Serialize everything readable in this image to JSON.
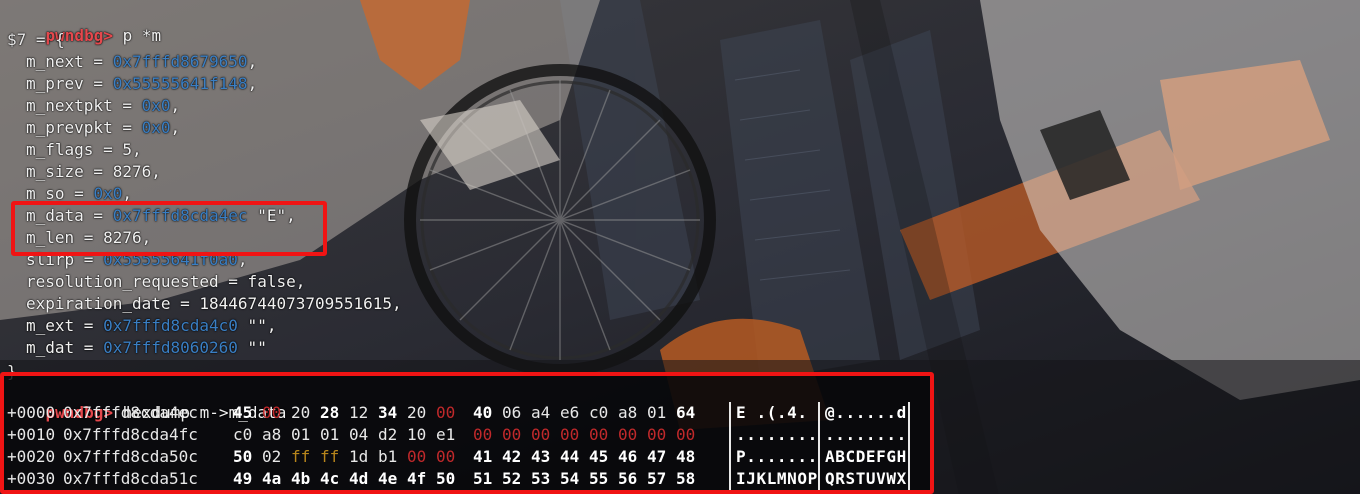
{
  "colors": {
    "prompt": "#e5484d",
    "address": "#3a7fc4",
    "highlight_border": "#f01414",
    "zero_byte": "#c0292b",
    "ff_byte": "#b8861b"
  },
  "print_cmd": {
    "prompt": "pwndbg>",
    "command": " p *m",
    "result_open": "$7 = {",
    "result_close": "}"
  },
  "fields": [
    {
      "name": "m_next = ",
      "addr": "0x7fffd8679650",
      "rest": ","
    },
    {
      "name": "m_prev = ",
      "addr": "0x55555641f148",
      "rest": ","
    },
    {
      "name": "m_nextpkt = ",
      "addr": "0x0",
      "rest": ","
    },
    {
      "name": "m_prevpkt = ",
      "addr": "0x0",
      "rest": ","
    },
    {
      "name": "m_flags = 5,",
      "addr": "",
      "rest": ""
    },
    {
      "name": "m_size = 8276,",
      "addr": "",
      "rest": ""
    },
    {
      "name": "m_so = ",
      "addr": "0x0",
      "rest": ","
    },
    {
      "name": "m_data = ",
      "addr": "0x7fffd8cda4ec",
      "rest": " \"E\","
    },
    {
      "name": "m_len = 8276,",
      "addr": "",
      "rest": ""
    },
    {
      "name": "slirp = ",
      "addr": "0x55555641f0a0",
      "rest": ","
    },
    {
      "name": "resolution_requested = false,",
      "addr": "",
      "rest": ""
    },
    {
      "name": "expiration_date = 18446744073709551615,",
      "addr": "",
      "rest": ""
    },
    {
      "name": "m_ext = ",
      "addr": "0x7fffd8cda4c0",
      "rest": " \"\","
    },
    {
      "name": "m_dat = ",
      "addr": "0x7fffd8060260",
      "rest": " \"\""
    }
  ],
  "hexdump_cmd": {
    "prompt": "pwndbg>",
    "command": " hexdump m->m_data"
  },
  "hexdump": [
    {
      "offset": "+0000",
      "address": "0x7fffd8cda4ec",
      "bytes": [
        {
          "v": "45",
          "s": "bold"
        },
        {
          "v": "00",
          "s": "red"
        },
        {
          "v": "20",
          "s": "norm"
        },
        {
          "v": "28",
          "s": "bold"
        },
        {
          "v": "12",
          "s": "norm"
        },
        {
          "v": "34",
          "s": "bold"
        },
        {
          "v": "20",
          "s": "norm"
        },
        {
          "v": "00",
          "s": "red"
        },
        {
          "v": "40",
          "s": "bold"
        },
        {
          "v": "06",
          "s": "norm"
        },
        {
          "v": "a4",
          "s": "norm"
        },
        {
          "v": "e6",
          "s": "norm"
        },
        {
          "v": "c0",
          "s": "norm"
        },
        {
          "v": "a8",
          "s": "norm"
        },
        {
          "v": "01",
          "s": "norm"
        },
        {
          "v": "64",
          "s": "bold"
        }
      ],
      "ascii1": "E .(.4. ",
      "ascii2": "@......d"
    },
    {
      "offset": "+0010",
      "address": "0x7fffd8cda4fc",
      "bytes": [
        {
          "v": "c0",
          "s": "norm"
        },
        {
          "v": "a8",
          "s": "norm"
        },
        {
          "v": "01",
          "s": "norm"
        },
        {
          "v": "01",
          "s": "norm"
        },
        {
          "v": "04",
          "s": "norm"
        },
        {
          "v": "d2",
          "s": "norm"
        },
        {
          "v": "10",
          "s": "norm"
        },
        {
          "v": "e1",
          "s": "norm"
        },
        {
          "v": "00",
          "s": "red"
        },
        {
          "v": "00",
          "s": "red"
        },
        {
          "v": "00",
          "s": "red"
        },
        {
          "v": "00",
          "s": "red"
        },
        {
          "v": "00",
          "s": "red"
        },
        {
          "v": "00",
          "s": "red"
        },
        {
          "v": "00",
          "s": "red"
        },
        {
          "v": "00",
          "s": "red"
        }
      ],
      "ascii1": "........",
      "ascii2": "........"
    },
    {
      "offset": "+0020",
      "address": "0x7fffd8cda50c",
      "bytes": [
        {
          "v": "50",
          "s": "bold"
        },
        {
          "v": "02",
          "s": "norm"
        },
        {
          "v": "ff",
          "s": "yel"
        },
        {
          "v": "ff",
          "s": "yel"
        },
        {
          "v": "1d",
          "s": "norm"
        },
        {
          "v": "b1",
          "s": "norm"
        },
        {
          "v": "00",
          "s": "red"
        },
        {
          "v": "00",
          "s": "red"
        },
        {
          "v": "41",
          "s": "bold"
        },
        {
          "v": "42",
          "s": "bold"
        },
        {
          "v": "43",
          "s": "bold"
        },
        {
          "v": "44",
          "s": "bold"
        },
        {
          "v": "45",
          "s": "bold"
        },
        {
          "v": "46",
          "s": "bold"
        },
        {
          "v": "47",
          "s": "bold"
        },
        {
          "v": "48",
          "s": "bold"
        }
      ],
      "ascii1": "P.......",
      "ascii2": "ABCDEFGH"
    },
    {
      "offset": "+0030",
      "address": "0x7fffd8cda51c",
      "bytes": [
        {
          "v": "49",
          "s": "bold"
        },
        {
          "v": "4a",
          "s": "bold"
        },
        {
          "v": "4b",
          "s": "bold"
        },
        {
          "v": "4c",
          "s": "bold"
        },
        {
          "v": "4d",
          "s": "bold"
        },
        {
          "v": "4e",
          "s": "bold"
        },
        {
          "v": "4f",
          "s": "bold"
        },
        {
          "v": "50",
          "s": "bold"
        },
        {
          "v": "51",
          "s": "bold"
        },
        {
          "v": "52",
          "s": "bold"
        },
        {
          "v": "53",
          "s": "bold"
        },
        {
          "v": "54",
          "s": "bold"
        },
        {
          "v": "55",
          "s": "bold"
        },
        {
          "v": "56",
          "s": "bold"
        },
        {
          "v": "57",
          "s": "bold"
        },
        {
          "v": "58",
          "s": "bold"
        }
      ],
      "ascii1": "IJKLMNOP",
      "ascii2": "QRSTUVWX"
    }
  ]
}
